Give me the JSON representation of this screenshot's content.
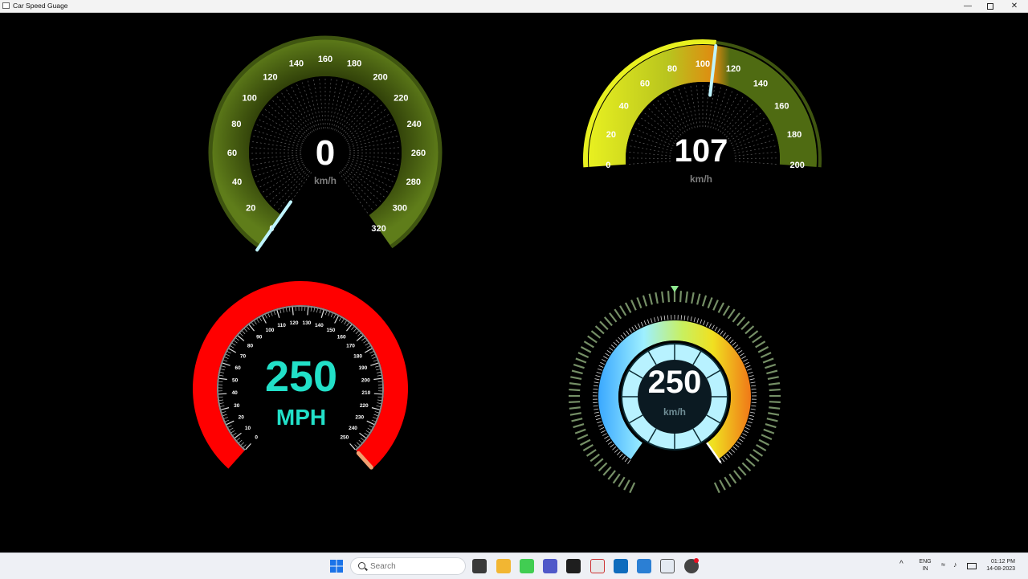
{
  "window": {
    "title": "Car Speed Guage"
  },
  "gauges": [
    {
      "id": "g1",
      "value": "0",
      "unit": "km/h",
      "ticks": [
        "0",
        "20",
        "40",
        "60",
        "80",
        "100",
        "120",
        "140",
        "160",
        "180",
        "200",
        "220",
        "240",
        "260",
        "280",
        "300",
        "320"
      ],
      "max": 320,
      "reading": 0
    },
    {
      "id": "g2",
      "value": "107",
      "unit": "km/h",
      "ticks": [
        "0",
        "20",
        "40",
        "60",
        "80",
        "100",
        "120",
        "140",
        "160",
        "180",
        "200"
      ],
      "max": 200,
      "reading": 107
    },
    {
      "id": "g3",
      "value": "250",
      "unit": "MPH",
      "ticks": [
        "0",
        "10",
        "20",
        "30",
        "40",
        "50",
        "60",
        "70",
        "80",
        "90",
        "100",
        "110",
        "120",
        "130",
        "140",
        "150",
        "160",
        "170",
        "180",
        "190",
        "200",
        "210",
        "220",
        "230",
        "240",
        "250"
      ],
      "max": 250,
      "reading": 250
    },
    {
      "id": "g4",
      "value": "250",
      "unit": "km/h",
      "max": 250,
      "reading": 250
    }
  ],
  "colors": {
    "green_gauge": "#4f6b12",
    "yellow_arc": "#e8f020",
    "red_ring": "#ff0000",
    "digital_cyan": "#22e0c8",
    "needle": "#bff4ff"
  },
  "taskbar": {
    "search_placeholder": "Search",
    "language": "ENG",
    "region": "IN",
    "time": "01:12 PM",
    "date": "14-08-2023"
  }
}
